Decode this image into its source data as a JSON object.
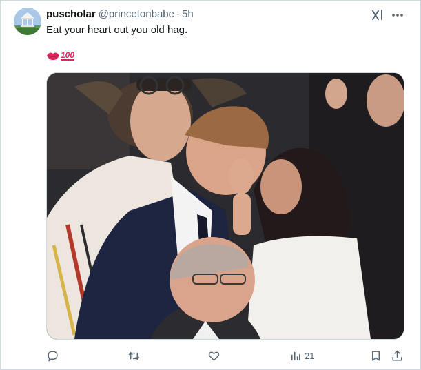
{
  "tweet": {
    "author": {
      "display_name": "puscholar",
      "handle": "@princetonbabe",
      "avatar_icon": "gazebo-avatar"
    },
    "separator": "·",
    "timestamp": "5h",
    "text": "Eat your heart out you old hag.",
    "emoji_line": {
      "icons": [
        "kiss-mark-emoji",
        "hundred-points-emoji"
      ],
      "hundred_text": "100"
    },
    "media": {
      "type": "photo"
    }
  },
  "header_actions": {
    "grok_icon": "grok-icon",
    "more_icon": "more-dots-icon"
  },
  "actions": {
    "reply_icon": "reply-icon",
    "retweet_icon": "retweet-icon",
    "like_icon": "heart-icon",
    "views_icon": "views-chart-icon",
    "views_count": "21",
    "bookmark_icon": "bookmark-icon",
    "share_icon": "share-icon"
  },
  "colors": {
    "text_primary": "#0f1419",
    "text_secondary": "#536471",
    "border": "#cfd9de",
    "emoji_red": "#e0245e"
  }
}
